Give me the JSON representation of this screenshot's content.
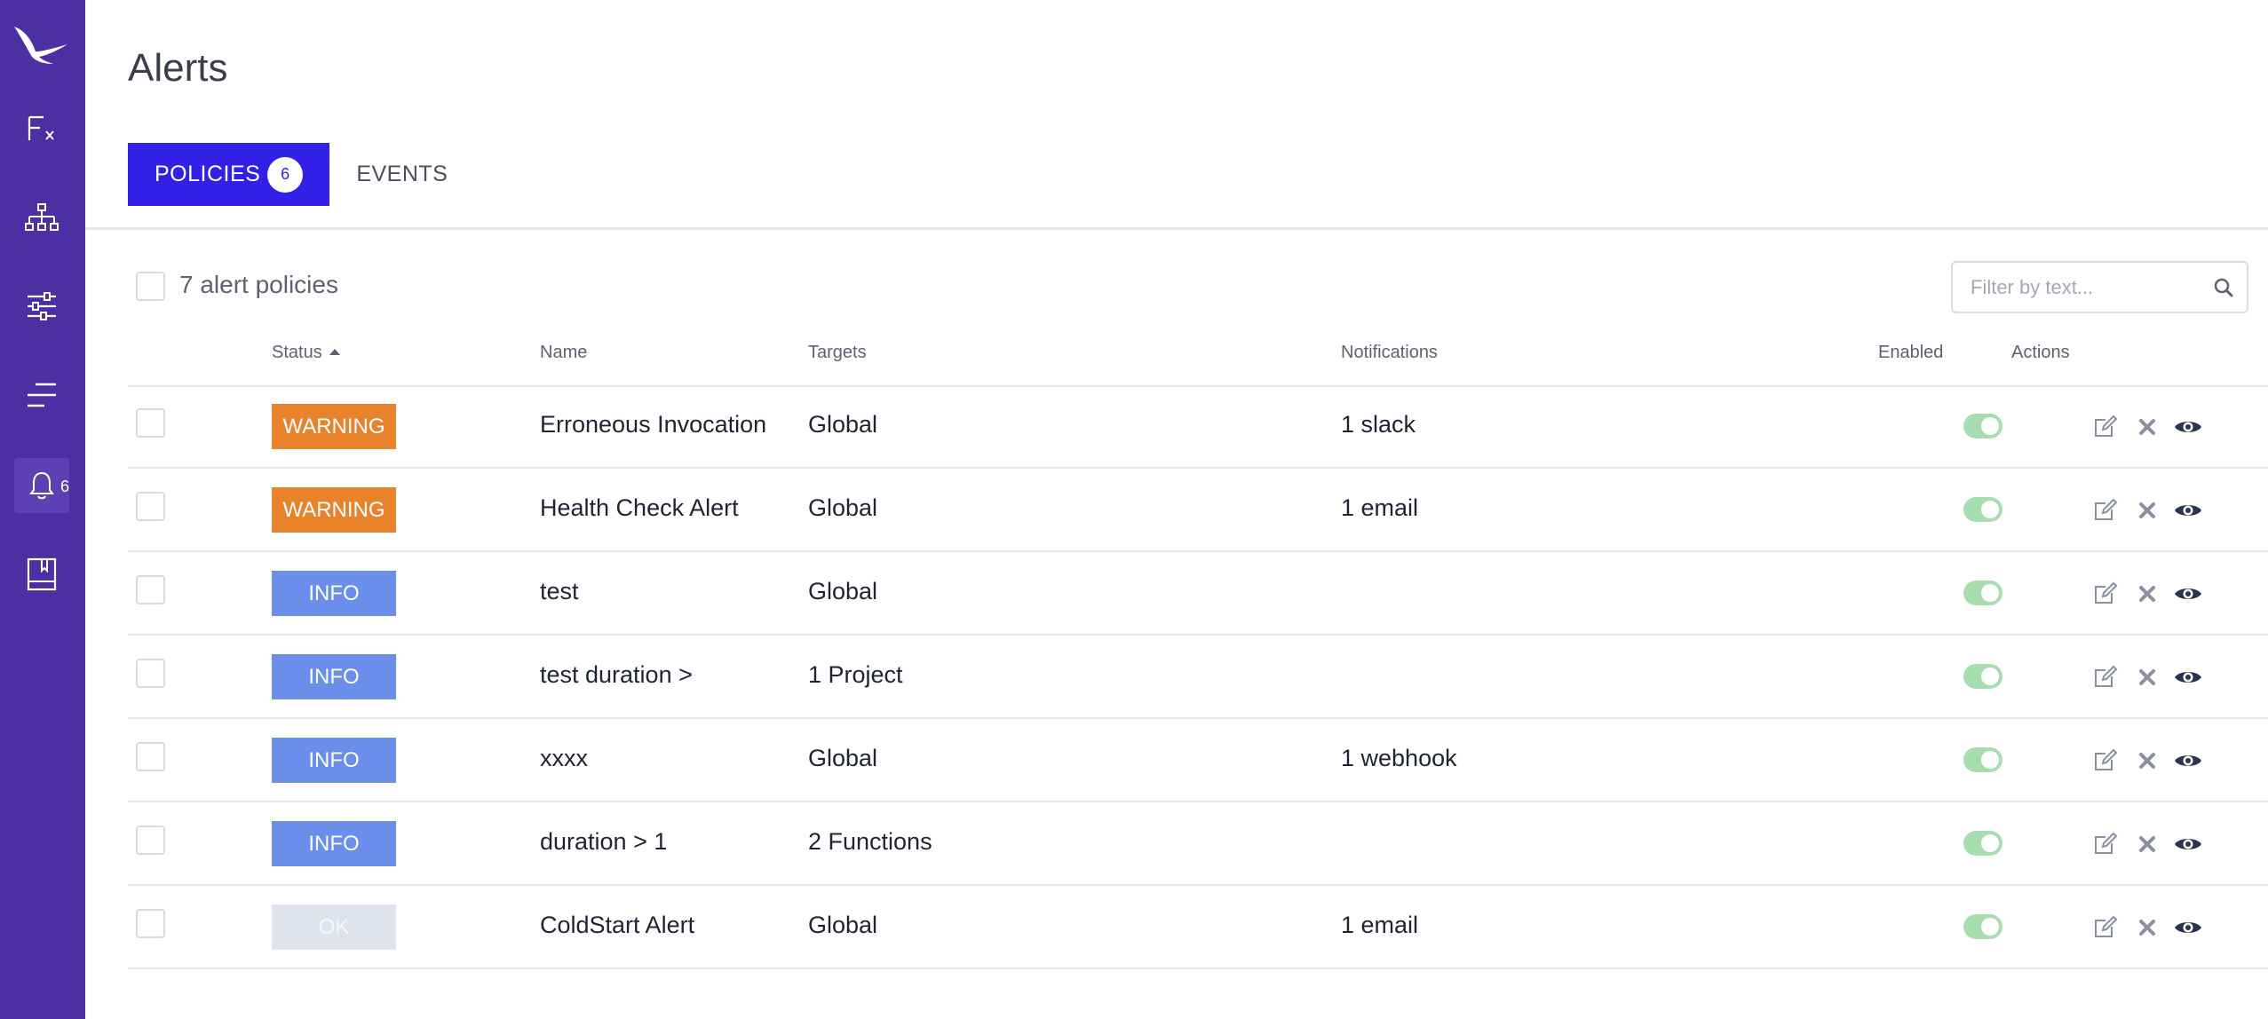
{
  "app": {
    "title": "Alerts"
  },
  "sidebar": {
    "items": [
      {
        "icon": "functions-icon"
      },
      {
        "icon": "hierarchy-icon"
      },
      {
        "icon": "sliders-icon"
      },
      {
        "icon": "list-icon"
      },
      {
        "icon": "bell-icon",
        "badge": "6"
      },
      {
        "icon": "book-icon"
      }
    ]
  },
  "tabs": [
    {
      "label": "POLICIES",
      "count": "6"
    },
    {
      "label": "EVENTS"
    }
  ],
  "toolbar": {
    "policy_count": "7 alert policies",
    "filter_placeholder": "Filter by text..."
  },
  "table": {
    "columns": [
      "Status",
      "Name",
      "Targets",
      "Notifications",
      "Enabled",
      "Actions"
    ],
    "rows": [
      {
        "status": "WARNING",
        "name": "Erroneous Invocation",
        "targets": "Global",
        "notifications": "1 slack",
        "enabled": true
      },
      {
        "status": "WARNING",
        "name": "Health Check Alert",
        "targets": "Global",
        "notifications": "1 email",
        "enabled": true
      },
      {
        "status": "INFO",
        "name": "test",
        "targets": "Global",
        "notifications": "",
        "enabled": true
      },
      {
        "status": "INFO",
        "name": "test duration >",
        "targets": "1 Project",
        "notifications": "",
        "enabled": true
      },
      {
        "status": "INFO",
        "name": "xxxx",
        "targets": "Global",
        "notifications": "1 webhook",
        "enabled": true
      },
      {
        "status": "INFO",
        "name": "duration > 1",
        "targets": "2 Functions",
        "notifications": "",
        "enabled": true
      },
      {
        "status": "OK",
        "name": "ColdStart Alert",
        "targets": "Global",
        "notifications": "1 email",
        "enabled": true
      }
    ]
  },
  "colors": {
    "sidebar": "#4b2fa3",
    "accent": "#3220e6",
    "warning": "#e8822b",
    "info": "#6b8eea",
    "ok": "#dfe3ed",
    "toggle_on": "#a8ddb0"
  }
}
